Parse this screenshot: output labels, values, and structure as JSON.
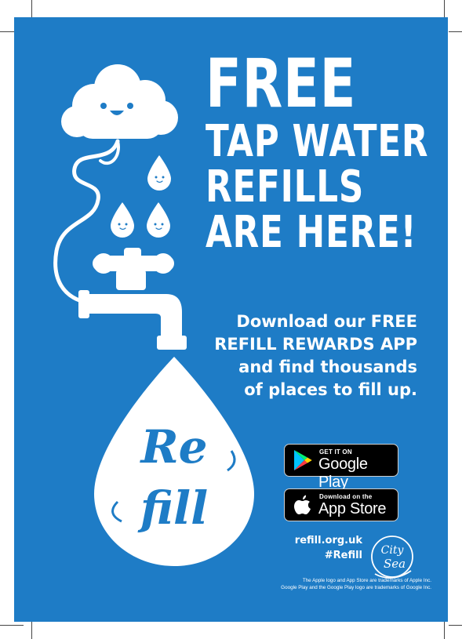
{
  "headline": {
    "line1": "FREE",
    "line2": "TAP WATER",
    "line3": "REFILLS",
    "line4": "ARE HERE!"
  },
  "blurb": {
    "line1": "Download our FREE",
    "line2": "REFILL REWARDS APP",
    "line3": "and find thousands",
    "line4": "of places to fill up."
  },
  "google_play": {
    "small": "GET IT ON",
    "name": "Google Play"
  },
  "app_store": {
    "small": "Download on the",
    "name": "App Store"
  },
  "drop_logo": "Refill",
  "website": "refill.org.uk",
  "hashtag": "#Refill",
  "partner_logo": "City to Sea",
  "fineprint": {
    "line1": "The Apple logo and App Store are trademarks of Apple Inc.",
    "line2": "Google Play and the Google Play logo are trademarks of Google Inc."
  },
  "colors": {
    "background": "#1e7cc6",
    "text": "#ffffff"
  }
}
